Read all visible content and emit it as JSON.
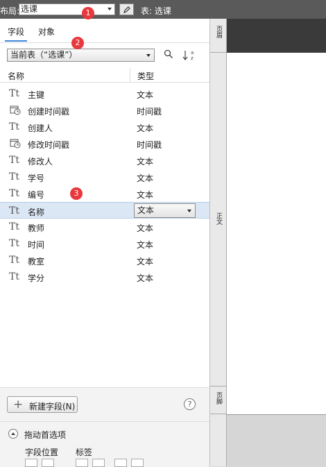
{
  "toolbar": {
    "layout_label": "布局:",
    "layout_value": "选课",
    "table_label": "表: 选课"
  },
  "badges": [
    "1",
    "2",
    "3"
  ],
  "tabs": [
    "字段",
    "对象"
  ],
  "table_select": "当前表（“选课”）",
  "columns": {
    "name": "名称",
    "type": "类型"
  },
  "fields": [
    {
      "name": "主键",
      "type": "文本",
      "icon": "text-icon"
    },
    {
      "name": "创建时间戳",
      "type": "时间戳",
      "icon": "timestamp-icon"
    },
    {
      "name": "创建人",
      "type": "文本",
      "icon": "text-icon"
    },
    {
      "name": "修改时间戳",
      "type": "时间戳",
      "icon": "timestamp-icon"
    },
    {
      "name": "修改人",
      "type": "文本",
      "icon": "text-icon"
    },
    {
      "name": "学号",
      "type": "文本",
      "icon": "text-icon"
    },
    {
      "name": "编号",
      "type": "文本",
      "icon": "text-icon"
    },
    {
      "name": "名称",
      "type": "文本",
      "icon": "text-icon",
      "selected": true
    },
    {
      "name": "教师",
      "type": "文本",
      "icon": "text-icon"
    },
    {
      "name": "时间",
      "type": "文本",
      "icon": "text-icon"
    },
    {
      "name": "教室",
      "type": "文本",
      "icon": "text-icon"
    },
    {
      "name": "学分",
      "type": "文本",
      "icon": "text-icon"
    }
  ],
  "text_icon_glyph": "Tt",
  "new_field_button": "新建字段(N)",
  "help_glyph": "?",
  "drag_options": "拖动首选项",
  "field_position": "字段位置",
  "labels": "标签",
  "bands": {
    "header": "页眉",
    "body": "正文",
    "footer": "页脚"
  },
  "colors": {
    "accent": "#3b86d6",
    "badge": "#e8383d",
    "selected_row": "#dbe7f5"
  }
}
